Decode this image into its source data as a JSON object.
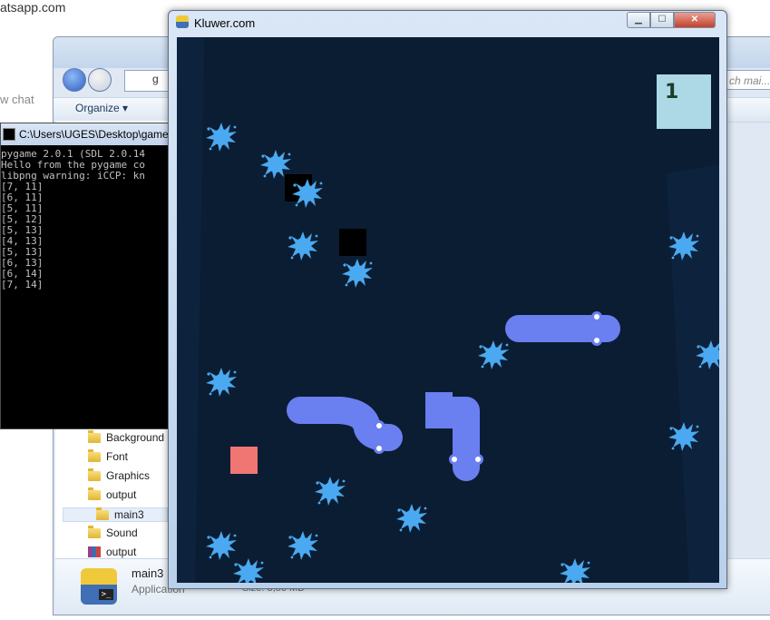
{
  "browser": {
    "url_fragment": "atsapp.com",
    "chat_fragment": "w chat"
  },
  "explorer": {
    "organize_label": "Organize",
    "address_fragment": "g",
    "search_placeholder": "ch mai...",
    "tree": [
      {
        "label": "Background",
        "icon": "folder-icon"
      },
      {
        "label": "Font",
        "icon": "folder-icon"
      },
      {
        "label": "Graphics",
        "icon": "folder-icon"
      },
      {
        "label": "output",
        "icon": "folder-icon"
      },
      {
        "label": "main3",
        "icon": "folder-icon",
        "selected": true
      },
      {
        "label": "Sound",
        "icon": "folder-icon"
      },
      {
        "label": "output",
        "icon": "archive-icon"
      }
    ],
    "details": {
      "name": "main3",
      "type": "Application",
      "size": "Size: 3,56 MB"
    }
  },
  "console": {
    "title": "C:\\Users\\UGES\\Desktop\\game\\c",
    "lines": [
      "pygame 2.0.1 (SDL 2.0.14",
      "Hello from the pygame co",
      "libpng warning: iCCP: kn",
      "[7, 11]",
      "[6, 11]",
      "[5, 11]",
      "[5, 12]",
      "[5, 13]",
      "[4, 13]",
      "[5, 13]",
      "[6, 13]",
      "[6, 14]",
      "[7, 14]"
    ]
  },
  "game": {
    "window_title": "Kluwer.com",
    "score": "1",
    "colors": {
      "background": "#0b1d33",
      "snake": "#6a7ff0",
      "splat": "#4aa9f0",
      "food": "#f07674",
      "score_box": "#add8e6",
      "obstacle": "#000000"
    }
  }
}
